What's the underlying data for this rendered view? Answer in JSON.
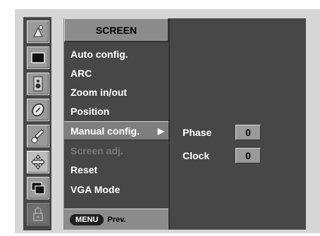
{
  "menu": {
    "title": "SCREEN",
    "items": [
      {
        "label": "Auto config.",
        "state": "normal"
      },
      {
        "label": "ARC",
        "state": "normal"
      },
      {
        "label": "Zoom in/out",
        "state": "normal"
      },
      {
        "label": "Position",
        "state": "normal"
      },
      {
        "label": "Manual config.",
        "state": "selected",
        "arrow": "▶"
      },
      {
        "label": "Screen adj.",
        "state": "disabled"
      },
      {
        "label": "Reset",
        "state": "normal"
      },
      {
        "label": "VGA Mode",
        "state": "normal"
      }
    ],
    "footer": {
      "button": "MENU",
      "label": "Prev."
    }
  },
  "submenu": {
    "rows": [
      {
        "label": "Phase",
        "value": "0"
      },
      {
        "label": "Clock",
        "value": "0"
      }
    ]
  },
  "icons": [
    {
      "name": "picture-icon",
      "state": "normal"
    },
    {
      "name": "screen-icon",
      "state": "normal"
    },
    {
      "name": "speaker-icon",
      "state": "normal"
    },
    {
      "name": "time-icon",
      "state": "normal"
    },
    {
      "name": "special-icon",
      "state": "normal"
    },
    {
      "name": "screen-adjust-icon",
      "state": "active"
    },
    {
      "name": "pip-icon",
      "state": "normal"
    },
    {
      "name": "lock-icon",
      "state": "dim"
    }
  ],
  "colors": {
    "panel": "#474747",
    "highlight": "#7e7e7e",
    "value_box": "#9a9a9a",
    "background": "#d6d6d6"
  }
}
